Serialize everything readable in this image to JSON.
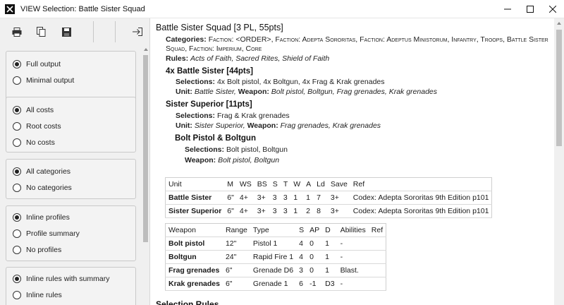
{
  "window": {
    "title": "VIEW Selection: Battle Sister Squad",
    "minimize": "—",
    "maximize": "☐",
    "close": "✕"
  },
  "toolbar": {
    "print_icon": "printer-icon",
    "copy_icon": "copy-icon",
    "save_icon": "floppy-icon",
    "exit_icon": "exit-icon"
  },
  "options": {
    "output": {
      "full": "Full output",
      "minimal": "Minimal output",
      "selected": "full"
    },
    "costs": {
      "all": "All costs",
      "root": "Root costs",
      "none": "No costs",
      "selected": "all"
    },
    "categories": {
      "all": "All categories",
      "none": "No categories",
      "selected": "all"
    },
    "profiles": {
      "inline": "Inline profiles",
      "summary": "Profile summary",
      "none": "No profiles",
      "selected": "inline"
    },
    "rules": {
      "inline_summary": "Inline rules with summary",
      "inline": "Inline rules",
      "selected": "inline_summary"
    }
  },
  "unit": {
    "heading": "Battle Sister Squad [3 PL, 55pts]",
    "categories_label": "Categories:",
    "categories_line1": "Faction: <ORDER>, Faction: Adepta Sororitas, Faction: Adeptus Ministorum, Infantry, Troops, Battle Sister",
    "categories_line2": "Squad, Faction: Imperium, Core",
    "rules_label": "Rules:",
    "rules_value": "Acts of Faith, Sacred Rites, Shield of Faith",
    "sub1": {
      "heading": "4x Battle Sister [44pts]",
      "selections_label": "Selections:",
      "selections_value": "4x Bolt pistol, 4x Boltgun, 4x Frag & Krak grenades",
      "unit_label": "Unit:",
      "unit_value": "Battle Sister,",
      "weapon_label": "Weapon:",
      "weapon_value": "Bolt pistol, Boltgun, Frag grenades, Krak grenades"
    },
    "sub2": {
      "heading": "Sister Superior [11pts]",
      "selections_label": "Selections:",
      "selections_value": "Frag & Krak grenades",
      "unit_label": "Unit:",
      "unit_value": "Sister Superior,",
      "weapon_label": "Weapon:",
      "weapon_value": "Frag grenades, Krak grenades"
    },
    "sub3": {
      "heading": "Bolt Pistol & Boltgun",
      "selections_label": "Selections:",
      "selections_value": "Bolt pistol, Boltgun",
      "weapon_label": "Weapon:",
      "weapon_value": "Bolt pistol, Boltgun"
    }
  },
  "unit_table": {
    "headers": [
      "Unit",
      "M",
      "WS",
      "BS",
      "S",
      "T",
      "W",
      "A",
      "Ld",
      "Save",
      "Ref"
    ],
    "rows": [
      [
        "Battle Sister",
        "6\"",
        "4+",
        "3+",
        "3",
        "3",
        "1",
        "1",
        "7",
        "3+",
        "Codex: Adepta Sororitas 9th Edition p101"
      ],
      [
        "Sister Superior",
        "6\"",
        "4+",
        "3+",
        "3",
        "3",
        "1",
        "2",
        "8",
        "3+",
        "Codex: Adepta Sororitas 9th Edition p101"
      ]
    ]
  },
  "weapon_table": {
    "headers": [
      "Weapon",
      "Range",
      "Type",
      "S",
      "AP",
      "D",
      "Abilities",
      "Ref"
    ],
    "rows": [
      [
        "Bolt pistol",
        "12\"",
        "Pistol 1",
        "4",
        "0",
        "1",
        "-",
        ""
      ],
      [
        "Boltgun",
        "24\"",
        "Rapid Fire 1",
        "4",
        "0",
        "1",
        "-",
        ""
      ],
      [
        "Frag grenades",
        "6\"",
        "Grenade D6",
        "3",
        "0",
        "1",
        "Blast.",
        ""
      ],
      [
        "Krak grenades",
        "6\"",
        "Grenade 1",
        "6",
        "-1",
        "D3",
        "-",
        ""
      ]
    ]
  },
  "selection_rules_heading": "Selection Rules"
}
